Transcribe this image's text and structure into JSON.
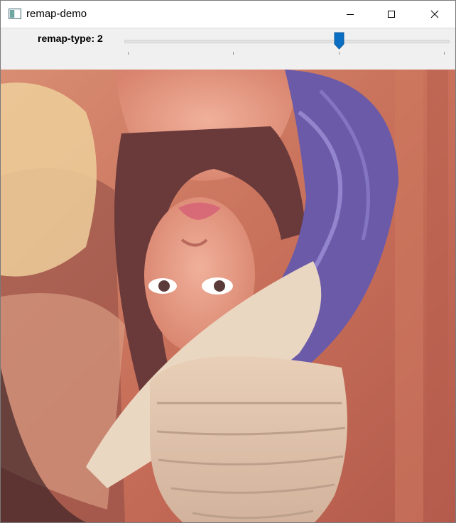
{
  "window": {
    "title": "remap-demo",
    "icon": "app-window-icon",
    "controls": {
      "minimize": "minimize-icon",
      "maximize": "maximize-icon",
      "close": "close-icon"
    }
  },
  "toolbar": {
    "trackbar_label": "remap-type: ",
    "trackbar_value": "2",
    "slider_level": 0.667,
    "accent_color": "#0a6fc2"
  },
  "image": {
    "description_icon": "image-canvas"
  }
}
